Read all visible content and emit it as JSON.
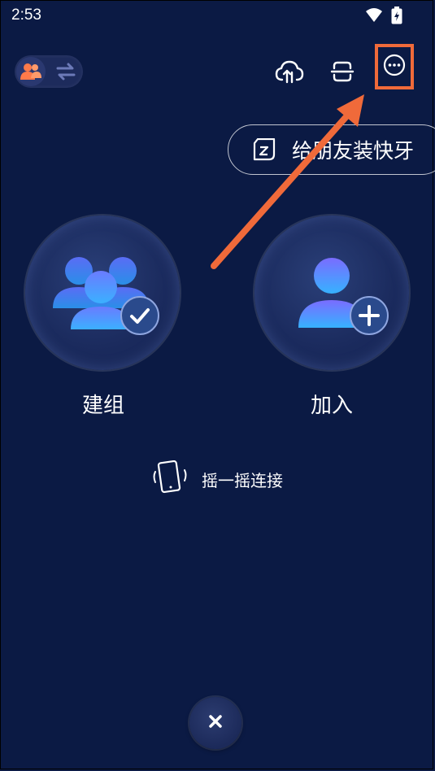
{
  "status_bar": {
    "time": "2:53"
  },
  "tooltip": {
    "text": "给朋友装快牙"
  },
  "actions": {
    "create_group_label": "建组",
    "join_label": "加入"
  },
  "shake": {
    "label": "摇一摇连接"
  },
  "colors": {
    "background": "#0b1a44",
    "highlight": "#f06a3a",
    "accent_blue": "#4f7dff"
  },
  "icons": [
    "wifi-icon",
    "battery-icon",
    "avatar-icon",
    "swap-icon",
    "cloud-upload-icon",
    "scan-icon",
    "more-icon",
    "app-icon",
    "group-icon",
    "check-icon",
    "add-user-icon",
    "plus-icon",
    "phone-shake-icon",
    "close-icon"
  ]
}
